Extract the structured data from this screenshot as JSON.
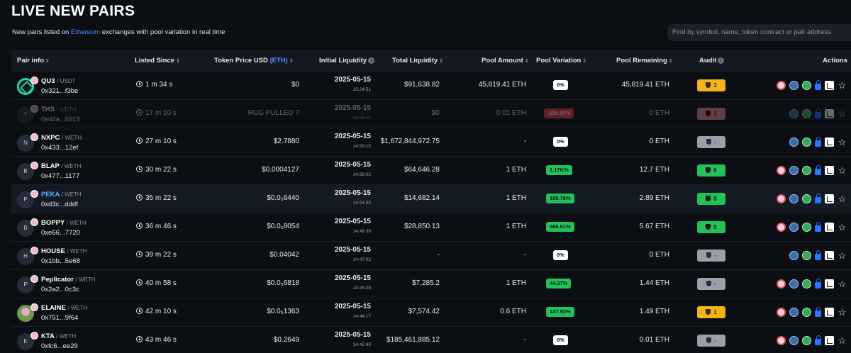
{
  "header": {
    "title": "LIVE NEW PAIRS",
    "subtitle_pre": "New pairs listed on",
    "subtitle_link": "Ethereum",
    "subtitle_post": "exchanges with pool variation in real time",
    "search_placeholder": "Find by symbol, name, token contract or pair address"
  },
  "columns": {
    "pair_info": "Pair info",
    "listed_since": "Listed Since",
    "token_price_pre": "Token Price USD",
    "token_price_unit": "(ETH)",
    "initial_liquidity": "Initial Liquidity",
    "total_liquidity": "Total Liquidity",
    "pool_amount": "Pool Amount",
    "pool_variation": "Pool Variation",
    "pool_remaining": "Pool Remaining",
    "audit": "Audit",
    "actions": "Actions"
  },
  "rows": [
    {
      "symbol": "QU3",
      "quote": "USDT",
      "address": "0x321...f3be",
      "avatar": "",
      "listed": "1 m 34 s",
      "price": "$0",
      "date": "2025-05-15",
      "time": "15:24:51",
      "total_liq": "$91,638.82",
      "pool_amount": "45,819.41 ETH",
      "variation": "0%",
      "variation_color": "white",
      "remaining": "45,819.41 ETH",
      "audit": "3",
      "audit_color": "yellow"
    },
    {
      "symbol": "THS",
      "quote": "WETH",
      "address": "0xd2a...6919",
      "avatar": "T",
      "listed": "17 m 10 s",
      "price": "RUG PULLED ?",
      "date": "2025-05-15",
      "time": "15:08:15",
      "total_liq": "$0",
      "pool_amount": "0.01 ETH",
      "variation": "-100.00%",
      "variation_color": "red",
      "remaining": "0 ETH",
      "audit": "3",
      "audit_color": "pink"
    },
    {
      "symbol": "NXPC",
      "quote": "WETH",
      "address": "0x433...12ef",
      "avatar": "N",
      "listed": "27 m 10 s",
      "price": "$2.7880",
      "date": "2025-05-15",
      "time": "14:59:15",
      "total_liq": "$1,672,844,972.75",
      "pool_amount": "-",
      "variation": "0%",
      "variation_color": "white",
      "remaining": "0 ETH",
      "audit": "-",
      "audit_color": "grey"
    },
    {
      "symbol": "BLAP",
      "quote": "WETH",
      "address": "0x477...1177",
      "avatar": "B",
      "listed": "30 m 22 s",
      "price": "$0.0004127",
      "date": "2025-05-15",
      "time": "14:56:02",
      "total_liq": "$64,646.28",
      "pool_amount": "1 ETH",
      "variation": "1.17K%",
      "variation_color": "green",
      "remaining": "12.7 ETH",
      "audit": "0",
      "audit_color": "green"
    },
    {
      "symbol": "PEKA",
      "quote": "WETH",
      "address": "0xd3c...dddf",
      "avatar": "P",
      "listed": "35 m 22 s",
      "price": "$0.0₅6440",
      "date": "2025-05-15",
      "time": "14:51:04",
      "total_liq": "$14,682.14",
      "pool_amount": "1 ETH",
      "variation": "188.76%",
      "variation_color": "green",
      "remaining": "2.89 ETH",
      "audit": "0",
      "audit_color": "green"
    },
    {
      "symbol": "BOPPY",
      "quote": "WETH",
      "address": "0xe66...7720",
      "avatar": "B",
      "listed": "36 m 46 s",
      "price": "$0.0₅8054",
      "date": "2025-05-15",
      "time": "14:49:39",
      "total_liq": "$28,850.13",
      "pool_amount": "1 ETH",
      "variation": "466.61%",
      "variation_color": "green",
      "remaining": "5.67 ETH",
      "audit": "0",
      "audit_color": "green"
    },
    {
      "symbol": "HOUSE",
      "quote": "WETH",
      "address": "0x1bb...5e68",
      "avatar": "H",
      "listed": "39 m 22 s",
      "price": "$0.04042",
      "date": "2025-05-15",
      "time": "14:47:02",
      "total_liq": "-",
      "pool_amount": "-",
      "variation": "0%",
      "variation_color": "white",
      "remaining": "0 ETH",
      "audit": "-",
      "audit_color": "grey"
    },
    {
      "symbol": "Peplicator",
      "quote": "WETH",
      "address": "0x2a2...0c3c",
      "avatar": "P",
      "listed": "40 m 58 s",
      "price": "$0.0₅6818",
      "date": "2025-05-15",
      "time": "14:45:28",
      "total_liq": "$7,285.2",
      "pool_amount": "1 ETH",
      "variation": "44.37%",
      "variation_color": "green",
      "remaining": "1.44 ETH",
      "audit": "-",
      "audit_color": "grey"
    },
    {
      "symbol": "ELAINE",
      "quote": "WETH",
      "address": "0x751...9f64",
      "avatar": "",
      "listed": "42 m 10 s",
      "price": "$0.0₅1363",
      "date": "2025-05-15",
      "time": "14:44:17",
      "total_liq": "$7,574.42",
      "pool_amount": "0.6 ETH",
      "variation": "147.93%",
      "variation_color": "green",
      "remaining": "1.49 ETH",
      "audit": "1",
      "audit_color": "yellow"
    },
    {
      "symbol": "KTA",
      "quote": "WETH",
      "address": "0xfc6...ee29",
      "avatar": "K",
      "listed": "43 m 46 s",
      "price": "$0.2649",
      "date": "2025-05-15",
      "time": "14:42:40",
      "total_liq": "$185,461,885.12",
      "pool_amount": "-",
      "variation": "0%",
      "variation_color": "white",
      "remaining": "0.01 ETH",
      "audit": "-",
      "audit_color": "grey"
    }
  ],
  "colors": {
    "background": "#0b0e13",
    "link": "#4c8dff",
    "green": "#24c05a",
    "red": "#ef3b47",
    "yellow": "#f4b41a"
  },
  "action_icons": [
    "token-sniffer-icon",
    "chart-icon",
    "globe-icon",
    "lock-icon",
    "dextools-icon",
    "star-icon"
  ]
}
